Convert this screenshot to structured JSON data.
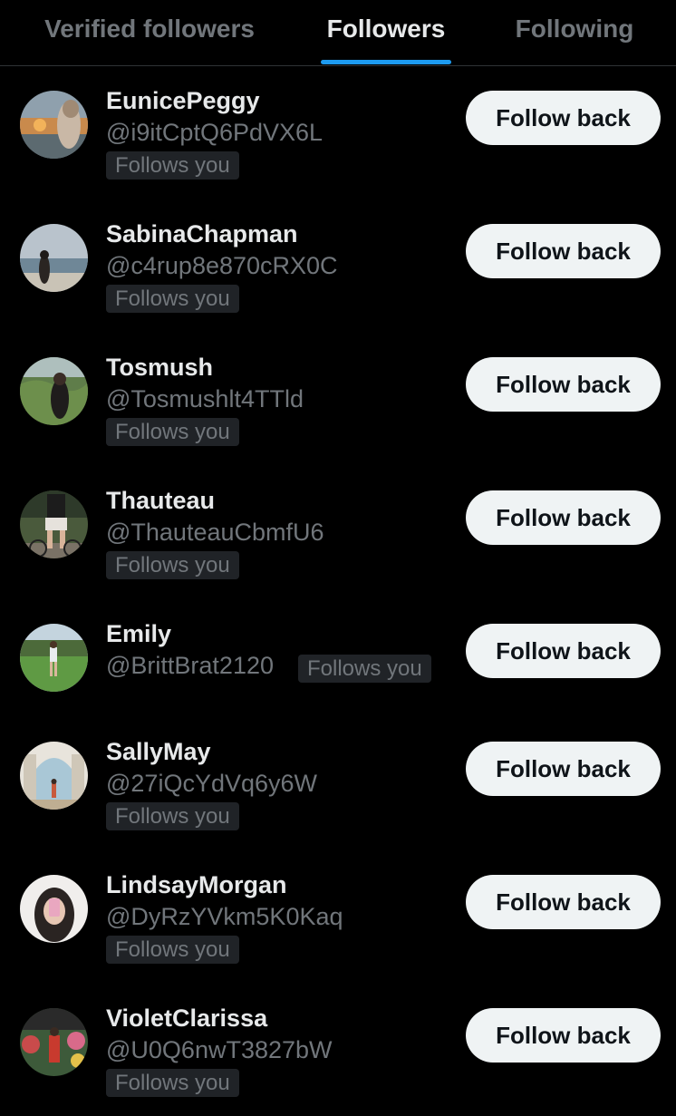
{
  "tabs": [
    {
      "label": "Verified followers",
      "active": false
    },
    {
      "label": "Followers",
      "active": true
    },
    {
      "label": "Following",
      "active": false
    }
  ],
  "accent_color": "#1d9bf0",
  "followers": [
    {
      "name": "EunicePeggy",
      "handle": "@i9itCptQ6PdVX6L",
      "badge": "Follows you",
      "button": "Follow back"
    },
    {
      "name": "SabinaChapman",
      "handle": "@c4rup8e870cRX0C",
      "badge": "Follows you",
      "button": "Follow back"
    },
    {
      "name": "Tosmush",
      "handle": "@Tosmushlt4TTld",
      "badge": "Follows you",
      "button": "Follow back"
    },
    {
      "name": "Thauteau",
      "handle": "@ThauteauCbmfU6",
      "badge": "Follows you",
      "button": "Follow back"
    },
    {
      "name": "Emily",
      "handle": "@BrittBrat2120",
      "badge": "Follows you",
      "button": "Follow back"
    },
    {
      "name": "SallyMay",
      "handle": "@27iQcYdVq6y6W",
      "badge": "Follows you",
      "button": "Follow back"
    },
    {
      "name": "LindsayMorgan",
      "handle": "@DyRzYVkm5K0Kaq",
      "badge": "Follows you",
      "button": "Follow back"
    },
    {
      "name": "VioletClarissa",
      "handle": "@U0Q6nwT3827bW",
      "badge": "Follows you",
      "button": "Follow back"
    }
  ]
}
